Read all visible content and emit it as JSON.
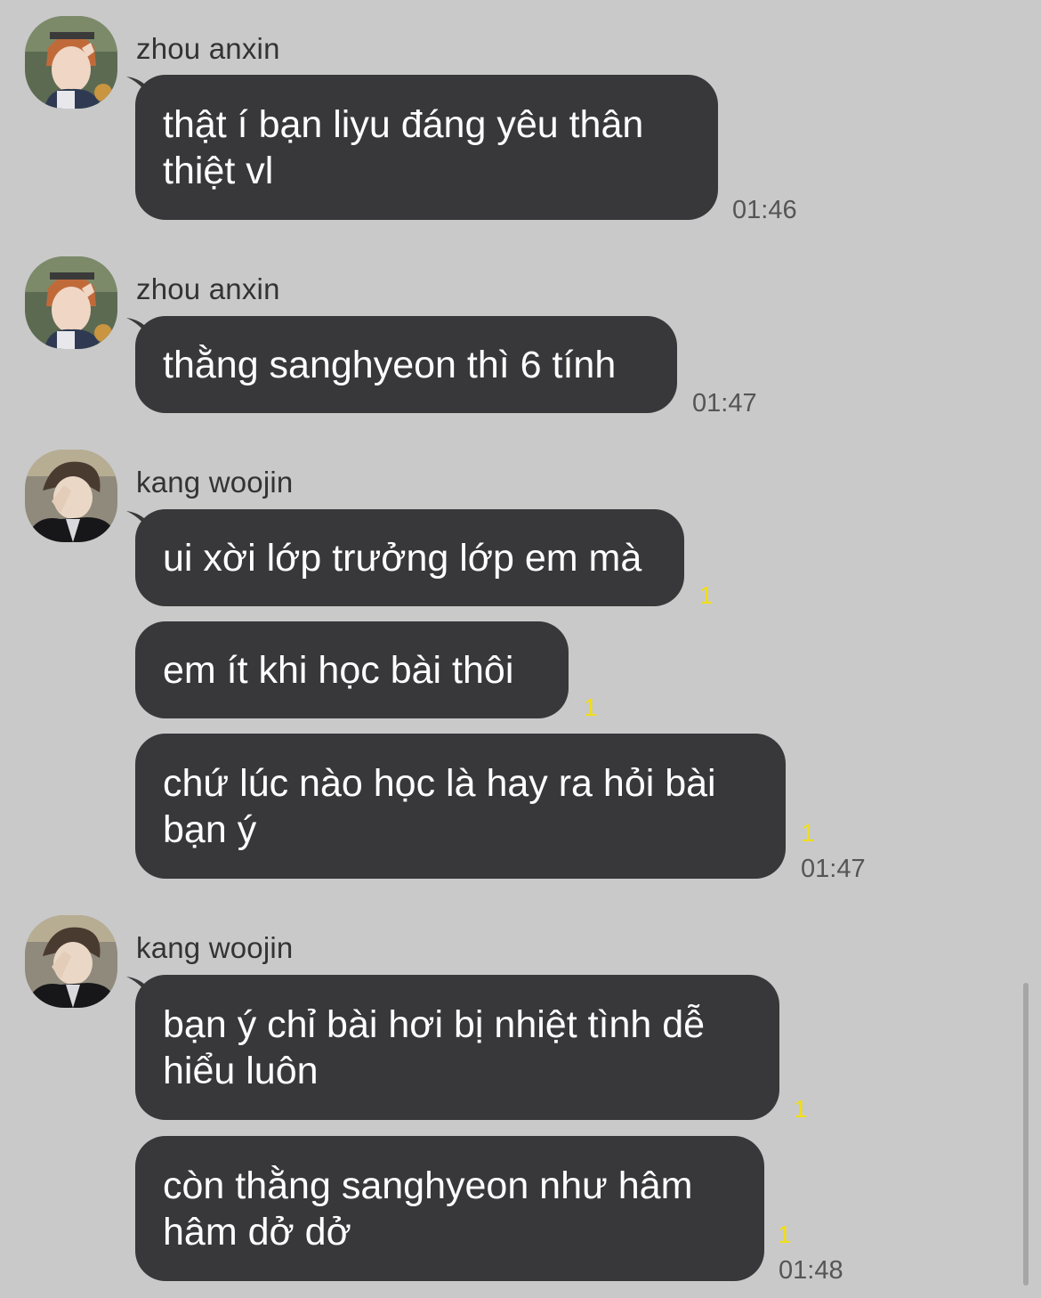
{
  "messages": [
    {
      "sender": "zhou anxin",
      "avatar_icon": "profile-photo-zhou-anxin",
      "bubbles": [
        {
          "lines": [
            "thật í bạn liyu đáng yêu thân",
            "thiệt vl"
          ],
          "unread": "",
          "time": "01:46"
        }
      ]
    },
    {
      "sender": "zhou anxin",
      "avatar_icon": "profile-photo-zhou-anxin",
      "bubbles": [
        {
          "lines": [
            "thằng sanghyeon thì 6 tính"
          ],
          "unread": "",
          "time": "01:47"
        }
      ]
    },
    {
      "sender": "kang woojin",
      "avatar_icon": "profile-photo-kang-woojin",
      "bubbles": [
        {
          "lines": [
            "ui xời lớp trưởng lớp em mà"
          ],
          "unread": "1",
          "time": ""
        },
        {
          "lines": [
            "em ít khi học bài thôi"
          ],
          "unread": "1",
          "time": ""
        },
        {
          "lines": [
            "chứ lúc nào học là hay ra hỏi bài",
            "bạn ý"
          ],
          "unread": "1",
          "time": "01:47"
        }
      ]
    },
    {
      "sender": "kang woojin",
      "avatar_icon": "profile-photo-kang-woojin",
      "bubbles": [
        {
          "lines": [
            "bạn ý chỉ bài hơi bị nhiệt tình dễ",
            "hiểu luôn"
          ],
          "unread": "1",
          "time": ""
        },
        {
          "lines": [
            "còn thằng sanghyeon như hâm",
            "hâm dở dở"
          ],
          "unread": "1",
          "time": "01:48"
        }
      ]
    }
  ],
  "colors": {
    "background": "#c9c9c9",
    "bubble": "#38383b",
    "bubble_text": "#ffffff",
    "unread": "#f1dd19",
    "timestamp": "#555555"
  }
}
